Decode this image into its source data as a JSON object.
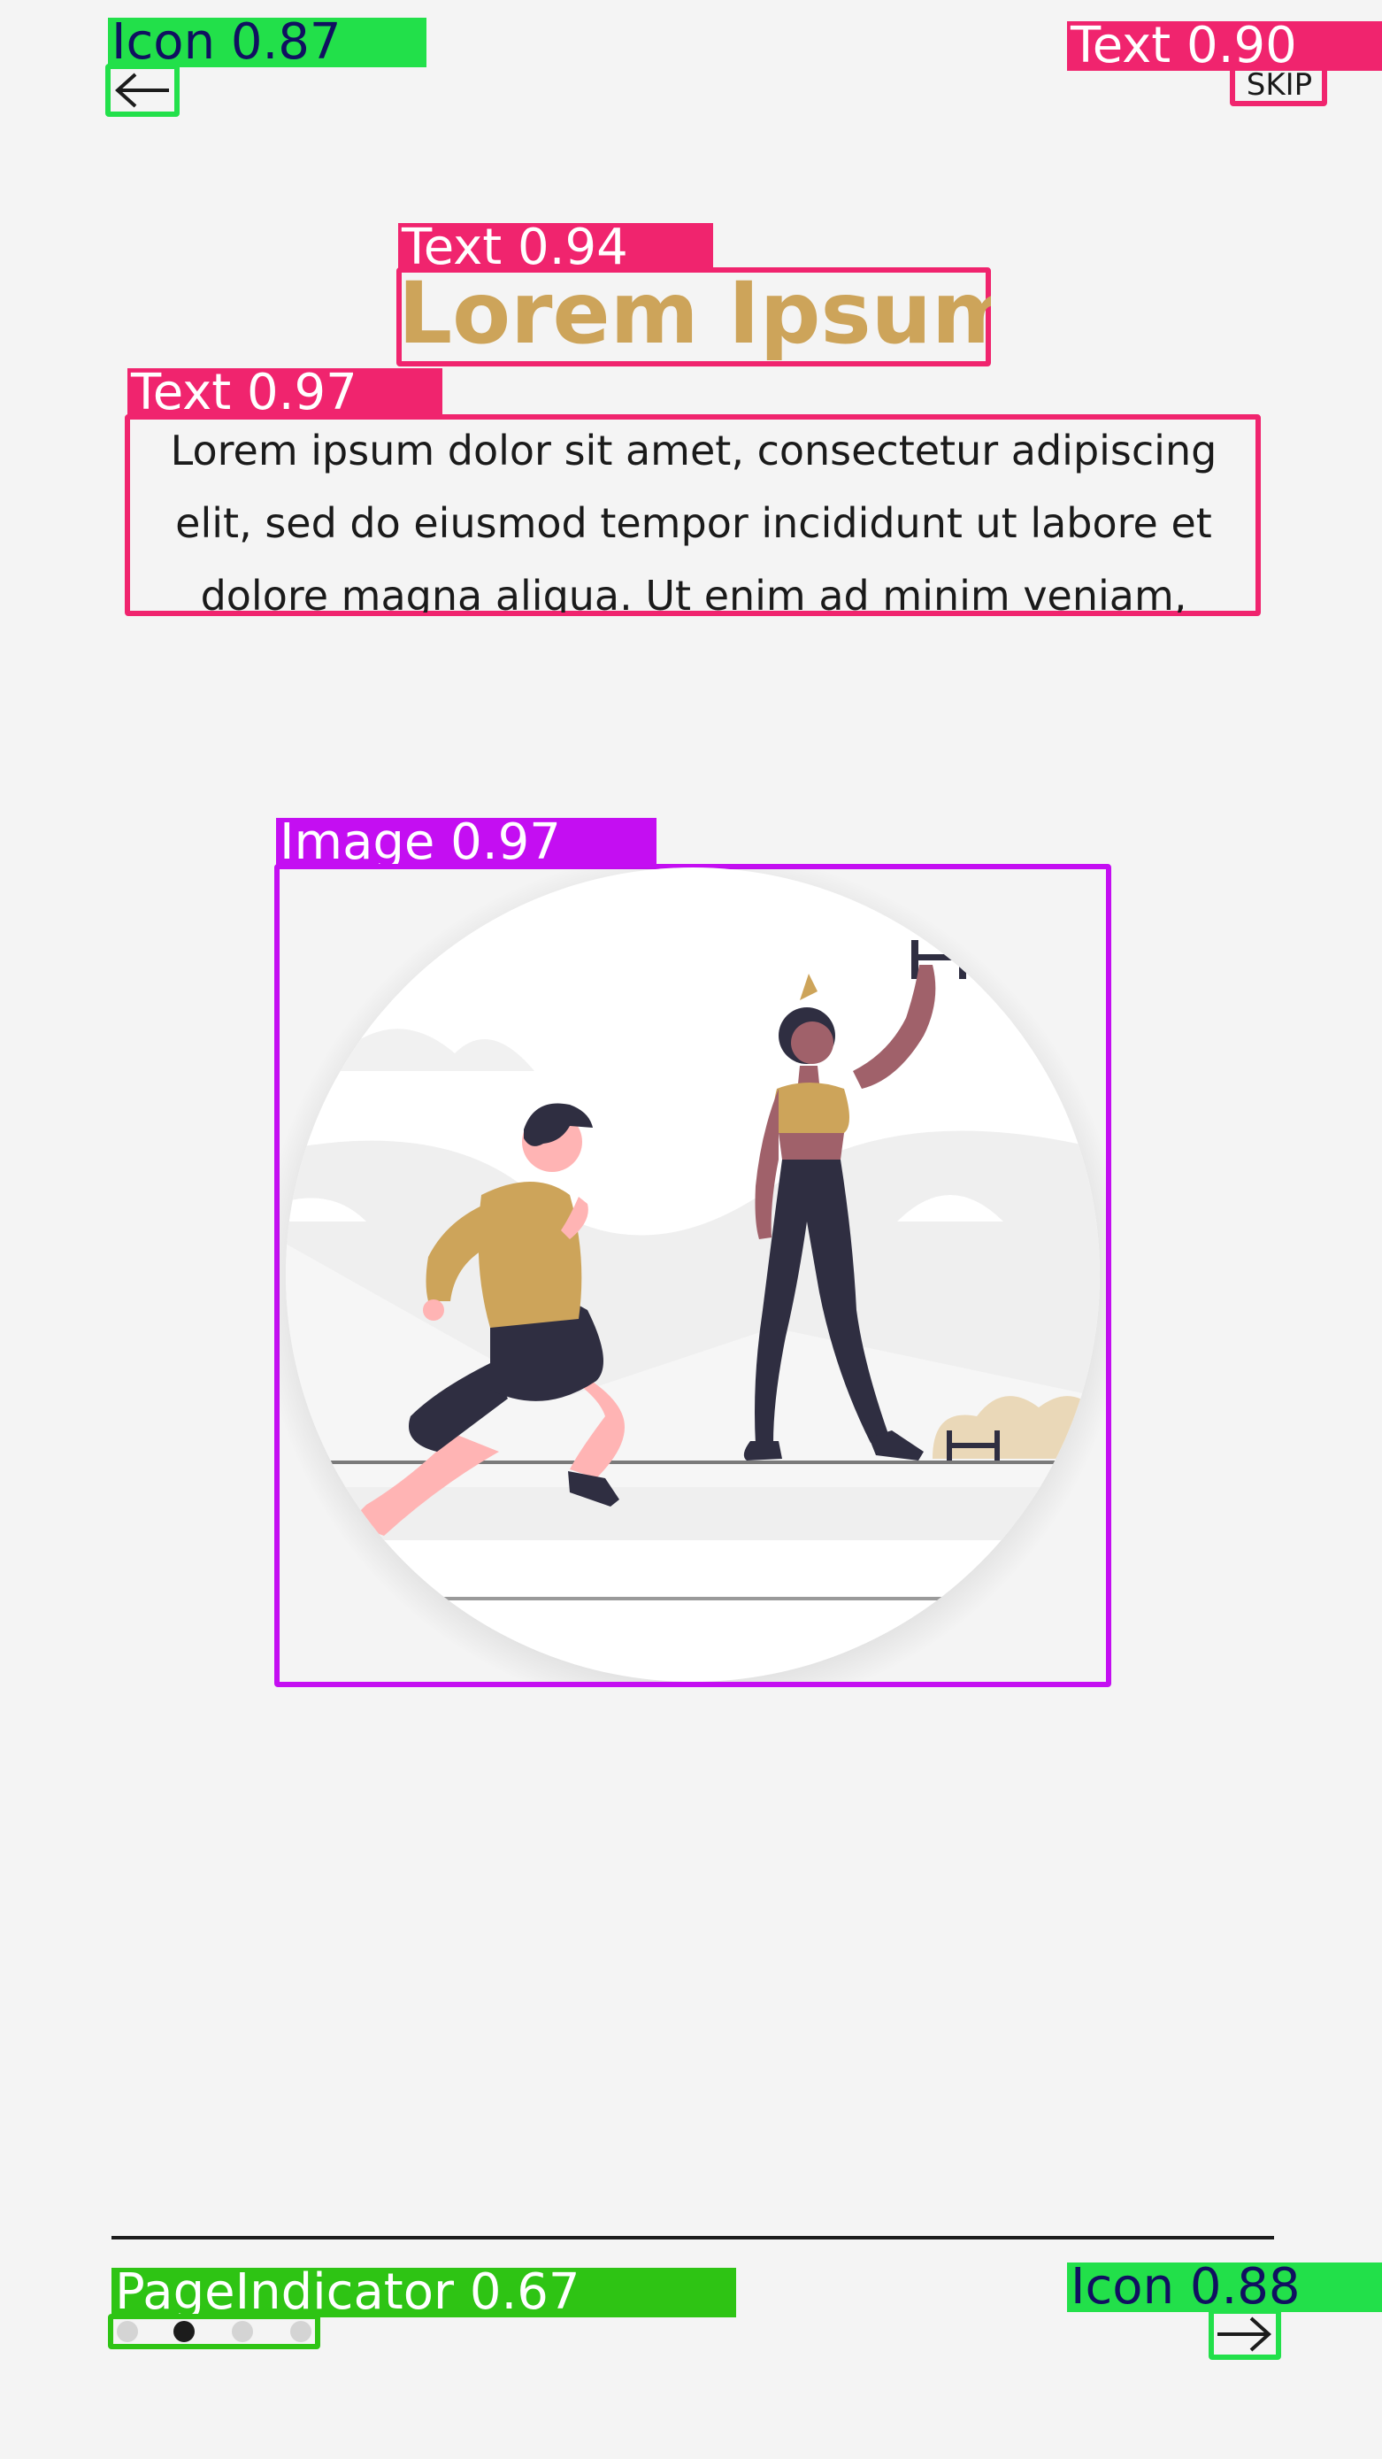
{
  "header": {
    "back_icon": "arrow-left-icon",
    "skip_label": "SKIP"
  },
  "content": {
    "title": "Lorem Ipsum",
    "description": "Lorem ipsum dolor sit amet, consectetur adipiscing elit, sed do eiusmod tempor incididunt ut labore et dolore magna aliqua. Ut enim ad minim veniam,"
  },
  "illustration": {
    "icon": "fitness-illustration"
  },
  "footer": {
    "page_indicator": {
      "count": 4,
      "active_index": 1
    },
    "next_icon": "arrow-right-icon"
  },
  "detections": {
    "back_icon": "Icon 0.87",
    "skip": "Text 0.90",
    "title": "Text 0.94",
    "description": "Text 0.97",
    "image": "Image 0.97",
    "page_indicator": "PageIndicator 0.67",
    "next_icon": "Icon 0.88"
  },
  "colors": {
    "accent": "#cda45a",
    "background": "#f4f4f4",
    "icon_box": "#22e04a",
    "text_box": "#f0246e",
    "image_box": "#c40ef2",
    "page_box": "#2ec414"
  }
}
